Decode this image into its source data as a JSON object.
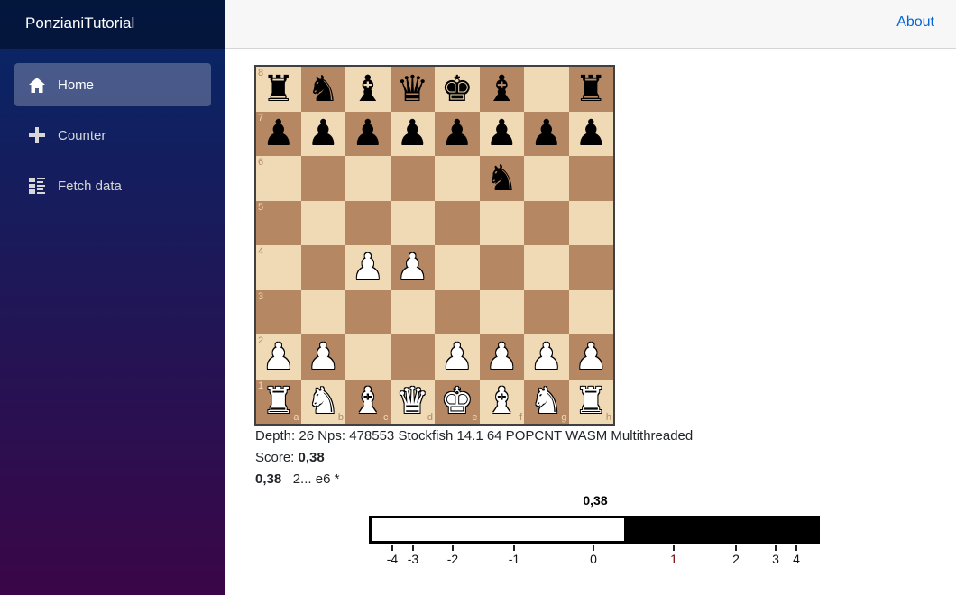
{
  "app": {
    "title": "PonzianiTutorial"
  },
  "sidebar": {
    "items": [
      {
        "label": "Home",
        "icon": "home-icon",
        "active": true
      },
      {
        "label": "Counter",
        "icon": "plus-icon",
        "active": false
      },
      {
        "label": "Fetch data",
        "icon": "list-icon",
        "active": false
      }
    ]
  },
  "header": {
    "about": "About"
  },
  "board": {
    "ranks": [
      "8",
      "7",
      "6",
      "5",
      "4",
      "3",
      "2",
      "1"
    ],
    "files": [
      "a",
      "b",
      "c",
      "d",
      "e",
      "f",
      "g",
      "h"
    ],
    "position": [
      "rnbqkb.r",
      "pppppppp",
      ".....n..",
      "........",
      "..PP....",
      "........",
      "PP..PPPP",
      "RNBQKBNR"
    ],
    "colors": {
      "light": "#f0d9b5",
      "dark": "#b58863"
    }
  },
  "engine": {
    "info": "Depth: 26 Nps: 478553 Stockfish 14.1 64 POPCNT WASM Multithreaded",
    "score_label": "Score:",
    "score": "0,38",
    "pv_score": "0,38",
    "pv": "2... e6 *"
  },
  "eval_bar": {
    "value": 0.38,
    "label": "0,38",
    "ticks": [
      "-4",
      "-3",
      "-2",
      "-1",
      "0",
      "1",
      "2",
      "3",
      "4"
    ]
  }
}
